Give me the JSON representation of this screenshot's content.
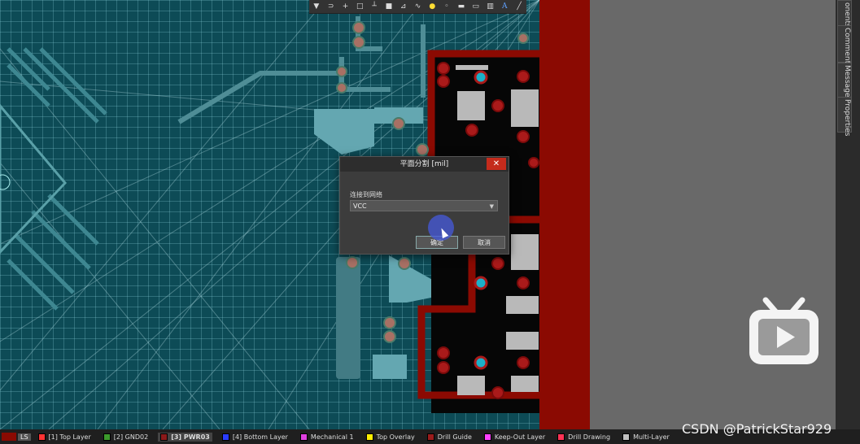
{
  "toolbar": {
    "icons": [
      "filter-icon",
      "route-icon",
      "cross-icon",
      "rect-select-icon",
      "align-icon",
      "component-icon",
      "pin-icon",
      "polygon-icon",
      "bulb-icon",
      "pad-icon",
      "fill-icon",
      "region-icon",
      "chart-icon",
      "text-icon",
      "line-icon"
    ]
  },
  "right_tabs": [
    "onents",
    "Comments",
    "Messages",
    "Properties"
  ],
  "dialog": {
    "title": "平面分割 [mil]",
    "close": "✕",
    "net_label": "连接到网络",
    "net_value": "VCC",
    "ok": "确定",
    "cancel": "取消"
  },
  "statusbar": {
    "ls": "LS",
    "layers": [
      {
        "label": "[1] Top Layer",
        "color": "#ff3333",
        "active": false
      },
      {
        "label": "[2] GND02",
        "color": "#3c9a2c",
        "active": false
      },
      {
        "label": "[3] PWR03",
        "color": "#8b1a1a",
        "active": true
      },
      {
        "label": "[4] Bottom Layer",
        "color": "#2a3cff",
        "active": false
      },
      {
        "label": "Mechanical 1",
        "color": "#e040e0",
        "active": false
      },
      {
        "label": "Top Overlay",
        "color": "#ffee00",
        "active": false
      },
      {
        "label": "Drill Guide",
        "color": "#9b1c1c",
        "active": false
      },
      {
        "label": "Keep-Out Layer",
        "color": "#ff40ff",
        "active": false
      },
      {
        "label": "Drill Drawing",
        "color": "#ff3355",
        "active": false
      },
      {
        "label": "Multi-Layer",
        "color": "#c0c0c0",
        "active": false
      }
    ]
  },
  "watermark": "CSDN @PatrickStar929"
}
